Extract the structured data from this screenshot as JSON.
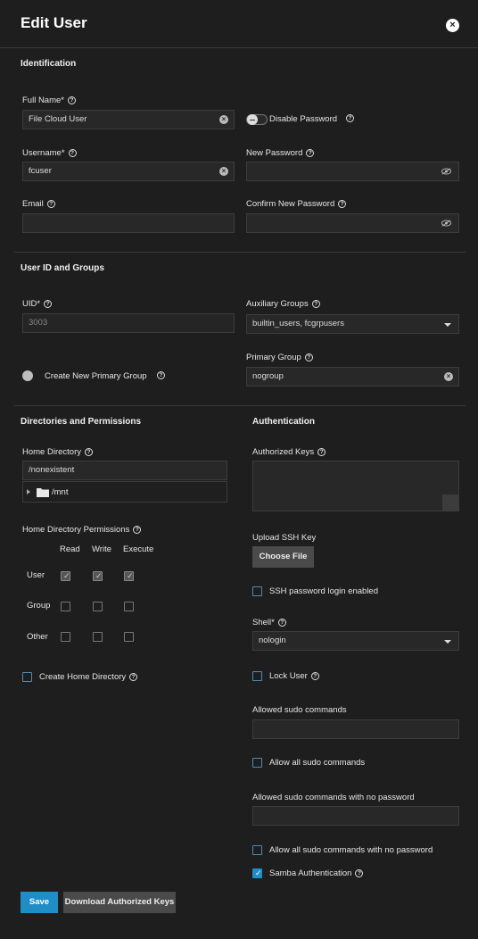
{
  "header": {
    "title": "Edit User",
    "close_icon": "×"
  },
  "identification": {
    "section": "Identification",
    "full_name_label": "Full Name*",
    "full_name_value": "File Cloud User",
    "disable_password_label": "Disable Password",
    "username_label": "Username*",
    "username_value": "fcuser",
    "new_password_label": "New Password",
    "email_label": "Email",
    "confirm_password_label": "Confirm New Password"
  },
  "ids": {
    "section": "User ID and Groups",
    "uid_label": "UID*",
    "uid_value": "3003",
    "aux_groups_label": "Auxiliary Groups",
    "aux_groups_value": "builtin_users, fcgrpusers",
    "create_primary_group_label": "Create New Primary Group",
    "primary_group_label": "Primary Group",
    "primary_group_value": "nogroup"
  },
  "dirs": {
    "section": "Directories and Permissions",
    "home_dir_label": "Home Directory",
    "home_dir_value": "/nonexistent",
    "tree_item": "/mnt",
    "perms_label": "Home Directory Permissions",
    "columns": [
      "Read",
      "Write",
      "Execute"
    ],
    "rows": [
      {
        "label": "User",
        "values": [
          true,
          true,
          true
        ]
      },
      {
        "label": "Group",
        "values": [
          false,
          false,
          false
        ]
      },
      {
        "label": "Other",
        "values": [
          false,
          false,
          false
        ]
      }
    ],
    "create_home_label": "Create Home Directory"
  },
  "auth": {
    "section": "Authentication",
    "authorized_keys_label": "Authorized Keys",
    "upload_ssh_label": "Upload SSH Key",
    "choose_file": "Choose File",
    "ssh_pw_login": "SSH password login enabled",
    "shell_label": "Shell*",
    "shell_value": "nologin",
    "lock_user": "Lock User",
    "sudo_label": "Allowed sudo commands",
    "allow_all_sudo": "Allow all sudo commands",
    "sudo_nopw_label": "Allowed sudo commands with no password",
    "allow_all_sudo_nopw": "Allow all sudo commands with no password",
    "samba_auth": "Samba Authentication"
  },
  "footer": {
    "save": "Save",
    "download_keys": "Download Authorized Keys"
  },
  "colors": {
    "accent": "#1f8ec6",
    "background": "#1e1e1e",
    "input_bg": "#282828"
  }
}
